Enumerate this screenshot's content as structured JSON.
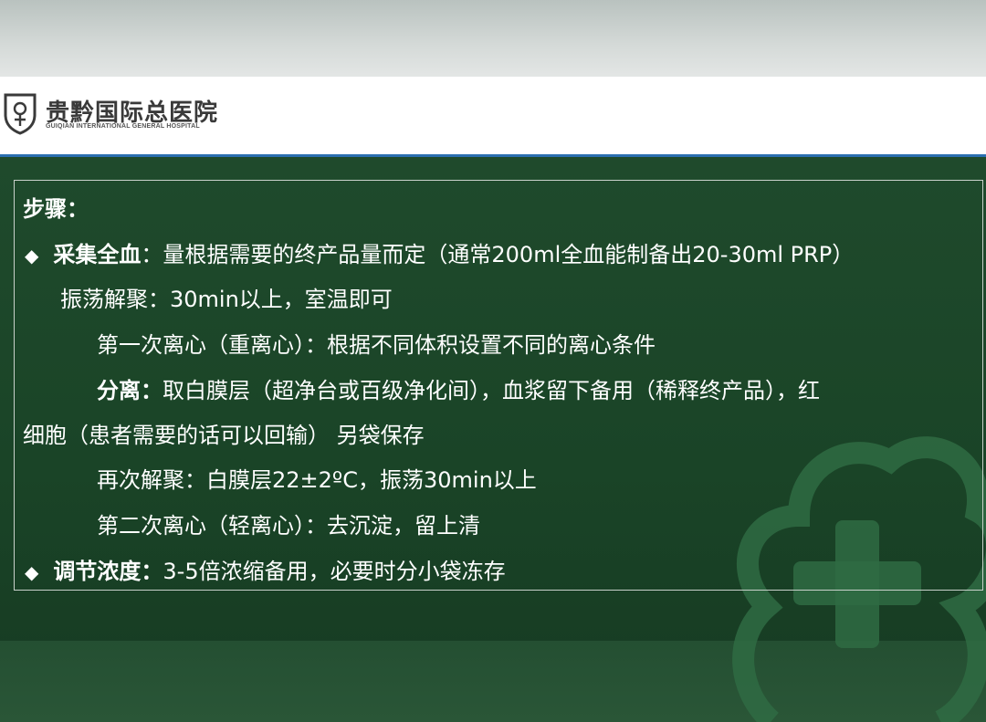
{
  "header": {
    "hospital_name_cn": "贵黔国际总医院",
    "hospital_name_en": "GUIQIAN INTERNATIONAL GENERAL HOSPITAL",
    "accent_color": "#2b6fb0"
  },
  "slide": {
    "background_color": "#1a4427",
    "watermark_icon": "cloud-cross-icon",
    "bullet_icon": "diamond-bullet-icon",
    "heading": "步骤：",
    "step1": {
      "bullet": "◆",
      "label": "采集全血",
      "text": "：量根据需要的终产品量而定（通常200ml全血能制备出20-30ml PRP）"
    },
    "step2": {
      "text": "振荡解聚：30min以上，室温即可"
    },
    "step3": {
      "text": "第一次离心（重离心）：根据不同体积设置不同的离心条件"
    },
    "step4": {
      "label": "分离：",
      "text": "取白膜层（超净台或百级净化间），血浆留下备用（稀释终产品），红",
      "continuation": "细胞（患者需要的话可以回输） 另袋保存"
    },
    "step5": {
      "text": "再次解聚：白膜层22±2ºC，振荡30min以上"
    },
    "step6": {
      "text": "第二次离心（轻离心）：去沉淀，留上清"
    },
    "step7": {
      "bullet": "◆",
      "label": "调节浓度：",
      "text": "3-5倍浓缩备用，必要时分小袋冻存"
    }
  }
}
